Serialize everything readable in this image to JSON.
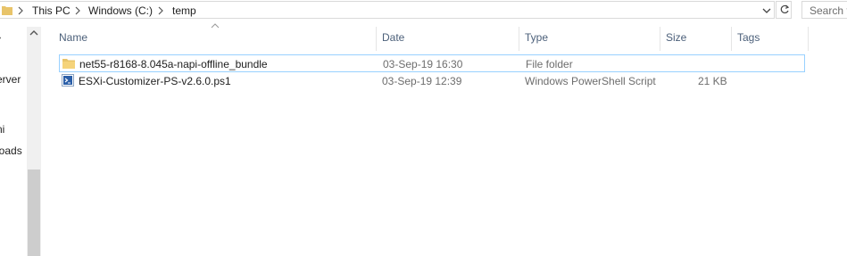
{
  "address_bar": {
    "breadcrumbs": [
      "This PC",
      "Windows (C:)",
      "temp"
    ],
    "search_placeholder": "Search t"
  },
  "nav_pane": {
    "items": [
      "erver",
      "ni",
      "loads"
    ]
  },
  "columns": [
    "Name",
    "Date",
    "Type",
    "Size",
    "Tags"
  ],
  "files": [
    {
      "name": "net55-r8168-8.045a-napi-offline_bundle",
      "date": "03-Sep-19 16:30",
      "type": "File folder",
      "size": "",
      "icon": "folder-icon"
    },
    {
      "name": "ESXi-Customizer-PS-v2.6.0.ps1",
      "date": "03-Sep-19 12:39",
      "type": "Windows PowerShell Script",
      "size": "21 KB",
      "icon": "powershell-script-icon"
    }
  ],
  "colors": {
    "folder": "#e8c46a",
    "selection_border": "#99d1ff",
    "header_text": "#4c607a"
  }
}
